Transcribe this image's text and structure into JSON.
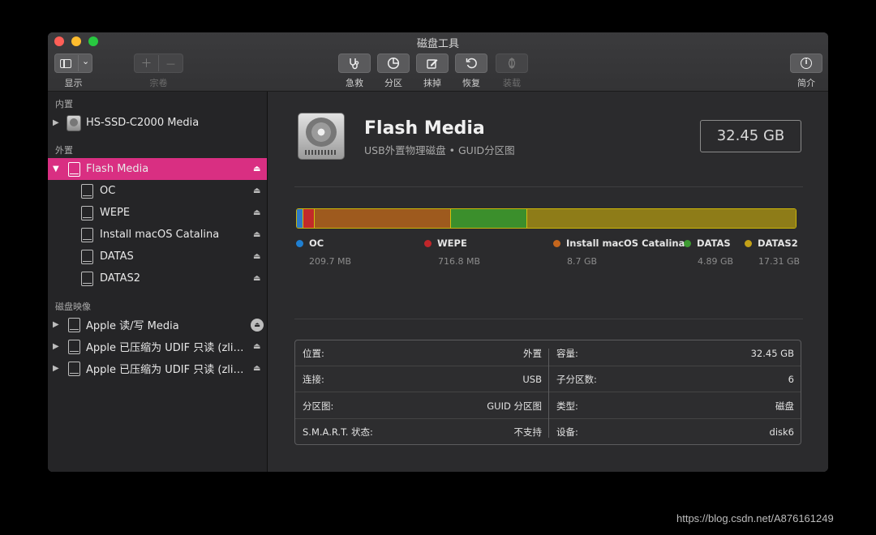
{
  "window": {
    "title": "磁盘工具"
  },
  "toolbar": {
    "view_label": "显示",
    "view_dropdown": "⌄",
    "add_symbol": "＋",
    "remove_symbol": "—",
    "volume_label": "宗卷",
    "first_aid_label": "急救",
    "partition_label": "分区",
    "erase_label": "抹掉",
    "restore_label": "恢复",
    "mount_label": "装载",
    "info_label": "简介"
  },
  "sidebar": {
    "internal_header": "内置",
    "internal_disk": "HS-SSD-C2000 Media",
    "external_header": "外置",
    "external_disk": "Flash Media",
    "volumes": [
      "OC",
      "WEPE",
      "Install macOS Catalina",
      "DATAS",
      "DATAS2"
    ],
    "images_header": "磁盘映像",
    "images": [
      "Apple 读/写 Media",
      "Apple 已压缩为 UDIF 只读 (zlib...",
      "Apple 已压缩为 UDIF 只读 (zlib..."
    ]
  },
  "disk": {
    "name": "Flash Media",
    "description": "USB外置物理磁盘 • GUID分区图",
    "capacity": "32.45 GB"
  },
  "partitions": [
    {
      "name": "OC",
      "size": "209.7 MB",
      "gb": 0.21,
      "color": "#2f7bc6"
    },
    {
      "name": "WEPE",
      "size": "716.8 MB",
      "gb": 0.72,
      "color": "#c22a2a"
    },
    {
      "name": "Install macOS Catalina",
      "size": "8.7 GB",
      "gb": 8.7,
      "color": "#9e5a1e"
    },
    {
      "name": "DATAS",
      "size": "4.89 GB",
      "gb": 4.89,
      "color": "#3b8f2c"
    },
    {
      "name": "DATAS2",
      "size": "17.31 GB",
      "gb": 17.31,
      "color": "#8e7c18"
    }
  ],
  "legend_dot_colors": [
    "#1f7fd1",
    "#c0262a",
    "#c4661d",
    "#3d9a32",
    "#c3a118"
  ],
  "info": {
    "location_k": "位置:",
    "location_v": "外置",
    "connection_k": "连接:",
    "connection_v": "USB",
    "scheme_k": "分区图:",
    "scheme_v": "GUID 分区图",
    "smart_k": "S.M.A.R.T. 状态:",
    "smart_v": "不支持",
    "capacity_k": "容量:",
    "capacity_v": "32.45 GB",
    "children_k": "子分区数:",
    "children_v": "6",
    "type_k": "类型:",
    "type_v": "磁盘",
    "device_k": "设备:",
    "device_v": "disk6"
  },
  "watermark": "https://blog.csdn.net/A876161249"
}
